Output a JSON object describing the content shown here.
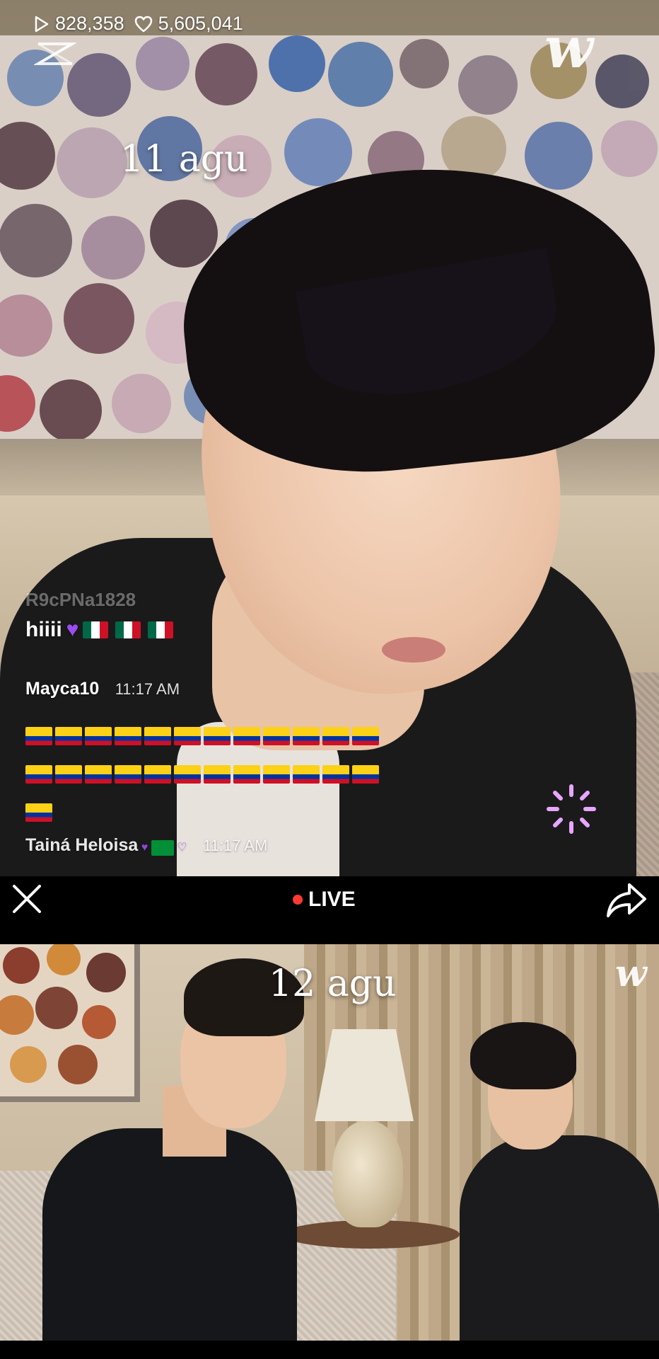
{
  "stats": {
    "views": "828,358",
    "likes": "5,605,041",
    "views_icon": "play-outline-icon",
    "likes_icon": "heart-outline-icon"
  },
  "overlays": {
    "date_top": "11 agu",
    "date_bottom": "12 agu",
    "brand_logo": "w"
  },
  "chat": {
    "faded_username": "R9cPNa1828",
    "message_1": "hiiii",
    "message_2": {
      "username": "Mayca10",
      "time": "11:17 AM",
      "flag_lines": [
        12,
        12,
        1
      ]
    },
    "message_3": {
      "username": "Tainá Heloisa",
      "time": "11:17 AM"
    }
  },
  "live_bar": {
    "label": "LIVE",
    "close_icon": "close-icon",
    "share_icon": "share-arrow-icon"
  },
  "colors": {
    "live_dot": "#ff3b30",
    "heart_purple": "#9b4cf0",
    "spinner": "#e8a6ff"
  }
}
